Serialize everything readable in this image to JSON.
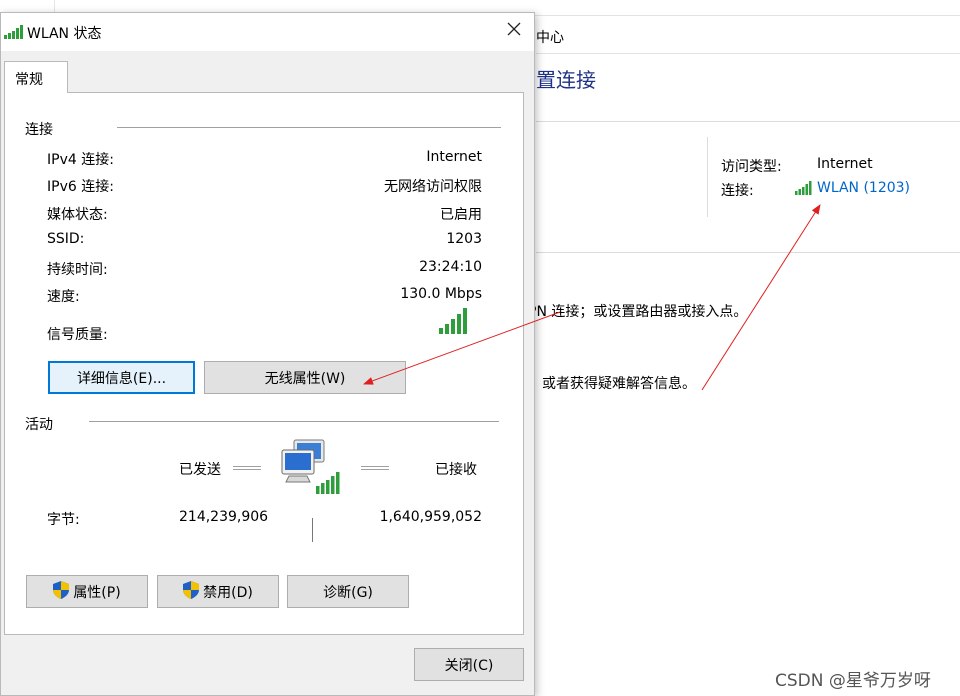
{
  "background_window": {
    "breadcrumb": "中心",
    "heading": "置连接",
    "access_type_label": "访问类型:",
    "access_type_value": "Internet",
    "connection_label": "连接:",
    "connection_link": "WLAN (1203)",
    "text_line1": "PN 连接；或设置路由器或接入点。",
    "text_line2": "，或者获得疑难解答信息。",
    "link_color": "#0066cc",
    "heading_color": "#1e3287"
  },
  "dialog": {
    "title": "WLAN 状态",
    "tab_label": "常规",
    "connection": {
      "group_label": "连接",
      "rows": [
        {
          "label": "IPv4 连接:",
          "value": "Internet"
        },
        {
          "label": "IPv6 连接:",
          "value": "无网络访问权限"
        },
        {
          "label": "媒体状态:",
          "value": "已启用"
        },
        {
          "label": "SSID:",
          "value": "1203"
        },
        {
          "label": "持续时间:",
          "value": "23:24:10"
        },
        {
          "label": "速度:",
          "value": "130.0 Mbps"
        }
      ],
      "signal_label": "信号质量:",
      "details_button": "详细信息(E)...",
      "wireless_props_button": "无线属性(W)"
    },
    "activity": {
      "group_label": "活动",
      "sent_label": "已发送",
      "received_label": "已接收",
      "bytes_label": "字节:",
      "bytes_sent": "214,239,906",
      "bytes_received": "1,640,959,052"
    },
    "buttons": {
      "properties": "属性(P)",
      "disable": "禁用(D)",
      "diagnose": "诊断(G)",
      "close": "关闭(C)"
    }
  },
  "watermark": "CSDN @星爷万岁呀",
  "colors": {
    "signal_green": "#2e9e3c",
    "annotation_red": "#e02020",
    "focus_blue": "#0078d7"
  }
}
